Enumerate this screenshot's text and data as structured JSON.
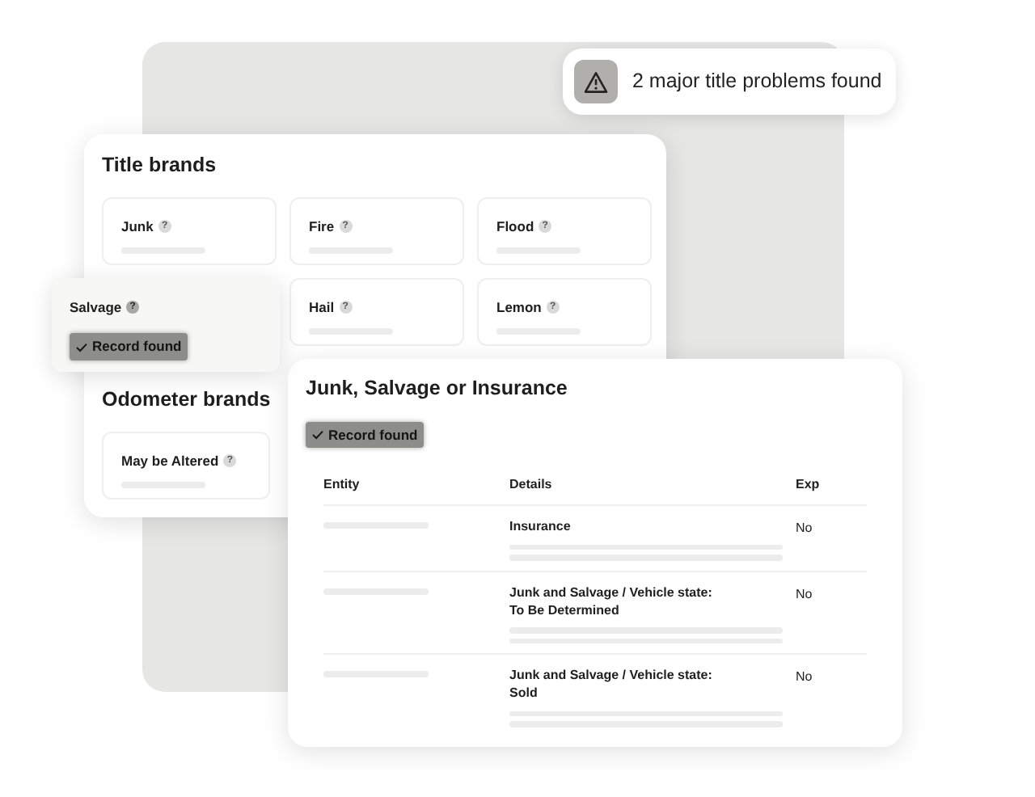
{
  "alert": {
    "text": "2 major title problems found"
  },
  "title_brands": {
    "title": "Title brands",
    "badge": "Record found",
    "tiles": [
      {
        "label": "Junk",
        "hint": "?",
        "record_found": false
      },
      {
        "label": "Fire",
        "hint": "?",
        "record_found": false
      },
      {
        "label": "Flood",
        "hint": "?",
        "record_found": false
      },
      {
        "label": "Salvage",
        "hint": "?",
        "record_found": true
      },
      {
        "label": "Hail",
        "hint": "?",
        "record_found": false
      },
      {
        "label": "Lemon",
        "hint": "?",
        "record_found": false
      }
    ]
  },
  "odometer_brands": {
    "title": "Odometer brands",
    "tiles": [
      {
        "label": "May be Altered",
        "hint": "?",
        "record_found": false
      }
    ]
  },
  "detail_card": {
    "title": "Junk, Salvage or Insurance",
    "badge": "Record found",
    "columns": [
      "Entity",
      "Details",
      "Exp"
    ],
    "rows": [
      {
        "details": "Insurance",
        "exp": "No"
      },
      {
        "details": "Junk and Salvage / Vehicle state: To Be Determined",
        "exp": "No"
      },
      {
        "details": "Junk and Salvage / Vehicle state: Sold",
        "exp": "No"
      }
    ]
  }
}
